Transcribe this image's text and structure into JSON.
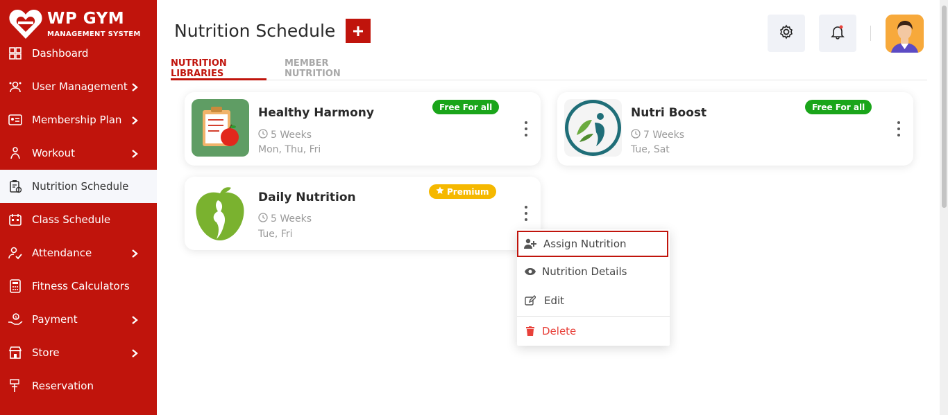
{
  "brand": {
    "title": "WP GYM",
    "subtitle": "MANAGEMENT SYSTEM"
  },
  "sidebar": {
    "items": [
      {
        "label": "Dashboard",
        "icon": "dashboard-icon",
        "chevron": false
      },
      {
        "label": "User Management",
        "icon": "users-gear-icon",
        "chevron": true
      },
      {
        "label": "Membership Plan",
        "icon": "membership-card-icon",
        "chevron": true
      },
      {
        "label": "Workout",
        "icon": "workout-icon",
        "chevron": true
      },
      {
        "label": "Nutrition Schedule",
        "icon": "nutrition-clipboard-icon",
        "chevron": false,
        "active": true
      },
      {
        "label": "Class Schedule",
        "icon": "calendar-icon",
        "chevron": false
      },
      {
        "label": "Attendance",
        "icon": "attendance-icon",
        "chevron": true
      },
      {
        "label": "Fitness Calculators",
        "icon": "calculator-icon",
        "chevron": false
      },
      {
        "label": "Payment",
        "icon": "payment-hand-icon",
        "chevron": true
      },
      {
        "label": "Store",
        "icon": "store-icon",
        "chevron": true
      },
      {
        "label": "Reservation",
        "icon": "reservation-icon",
        "chevron": false
      }
    ]
  },
  "header": {
    "title": "Nutrition Schedule"
  },
  "tabs": [
    {
      "label": "NUTRITION LIBRARIES",
      "active": true
    },
    {
      "label": "MEMBER NUTRITION",
      "active": false
    }
  ],
  "cards": [
    {
      "name": "Healthy Harmony",
      "duration": "5 Weeks",
      "days": "Mon, Thu, Fri",
      "badge": "Free For all",
      "badge_type": "free"
    },
    {
      "name": "Nutri Boost",
      "duration": "7 Weeks",
      "days": "Tue, Sat",
      "badge": "Free For all",
      "badge_type": "free"
    },
    {
      "name": "Daily Nutrition",
      "duration": "5 Weeks",
      "days": "Tue, Fri",
      "badge": "Premium",
      "badge_type": "premium"
    }
  ],
  "menu": {
    "assign": "Assign Nutrition",
    "details": "Nutrition Details",
    "edit": "Edit",
    "delete": "Delete"
  },
  "colors": {
    "brand_red": "#c0140c",
    "free_green": "#1aa51a",
    "premium_yellow": "#f5b800",
    "delete_red": "#e8413a"
  }
}
